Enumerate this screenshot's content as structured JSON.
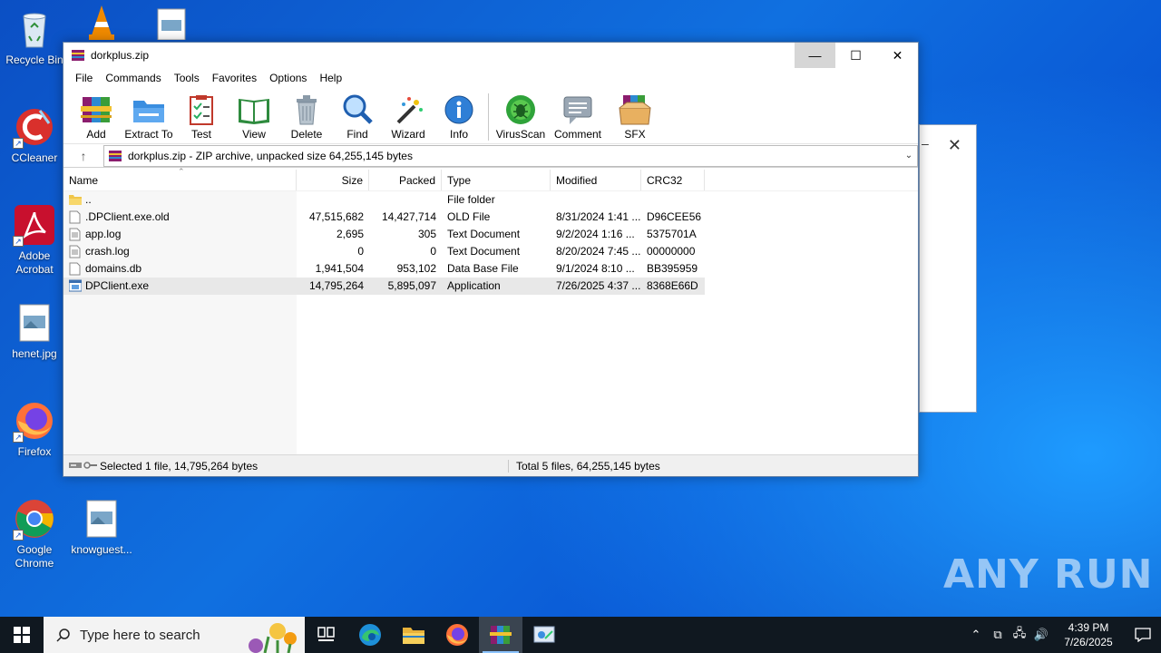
{
  "desktop": {
    "icons": [
      {
        "label": "Recycle Bin"
      },
      {
        "label": "CCleaner"
      },
      {
        "label": "Adobe Acrobat"
      },
      {
        "label": "henet.jpg"
      },
      {
        "label": "Firefox"
      },
      {
        "label": "Google Chrome"
      },
      {
        "label": "knowguest..."
      }
    ],
    "watermark": "ANY RUN"
  },
  "window": {
    "title": "dorkplus.zip",
    "controls": {
      "minimize": "—",
      "maximize": "☐",
      "close": "✕"
    },
    "menu": [
      "File",
      "Commands",
      "Tools",
      "Favorites",
      "Options",
      "Help"
    ],
    "toolbar": [
      {
        "label": "Add",
        "icon": "add-archive-icon"
      },
      {
        "label": "Extract To",
        "icon": "extract-folder-icon"
      },
      {
        "label": "Test",
        "icon": "test-clipboard-icon"
      },
      {
        "label": "View",
        "icon": "view-book-icon"
      },
      {
        "label": "Delete",
        "icon": "trash-icon"
      },
      {
        "label": "Find",
        "icon": "magnifier-icon"
      },
      {
        "label": "Wizard",
        "icon": "magic-wand-icon"
      },
      {
        "label": "Info",
        "icon": "info-icon"
      },
      {
        "label": "VirusScan",
        "icon": "virus-scan-icon"
      },
      {
        "label": "Comment",
        "icon": "comment-icon"
      },
      {
        "label": "SFX",
        "icon": "sfx-box-icon"
      }
    ],
    "address": {
      "path": "dorkplus.zip - ZIP archive, unpacked size 64,255,145 bytes"
    },
    "columns": {
      "name": "Name",
      "size": "Size",
      "packed": "Packed",
      "type": "Type",
      "modified": "Modified",
      "crc": "CRC32"
    },
    "files": [
      {
        "name": "..",
        "size": "",
        "packed": "",
        "type": "File folder",
        "modified": "",
        "crc": "",
        "icon": "folder"
      },
      {
        "name": ".DPClient.exe.old",
        "size": "47,515,682",
        "packed": "14,427,714",
        "type": "OLD File",
        "modified": "8/31/2024 1:41 ...",
        "crc": "D96CEE56",
        "icon": "file"
      },
      {
        "name": "app.log",
        "size": "2,695",
        "packed": "305",
        "type": "Text Document",
        "modified": "9/2/2024 1:16 ...",
        "crc": "5375701A",
        "icon": "text"
      },
      {
        "name": "crash.log",
        "size": "0",
        "packed": "0",
        "type": "Text Document",
        "modified": "8/20/2024 7:45 ...",
        "crc": "00000000",
        "icon": "text"
      },
      {
        "name": "domains.db",
        "size": "1,941,504",
        "packed": "953,102",
        "type": "Data Base File",
        "modified": "9/1/2024 8:10 ...",
        "crc": "BB395959",
        "icon": "file"
      },
      {
        "name": "DPClient.exe",
        "size": "14,795,264",
        "packed": "5,895,097",
        "type": "Application",
        "modified": "7/26/2025 4:37 ...",
        "crc": "8368E66D",
        "icon": "exe",
        "selected": true
      }
    ],
    "status": {
      "left": "Selected 1 file, 14,795,264 bytes",
      "right": "Total 5 files, 64,255,145 bytes"
    }
  },
  "taskbar": {
    "search_placeholder": "Type here to search",
    "apps": [
      "task-view",
      "edge",
      "file-explorer",
      "firefox",
      "winrar",
      "control-panel"
    ],
    "time": "4:39 PM",
    "date": "7/26/2025"
  }
}
